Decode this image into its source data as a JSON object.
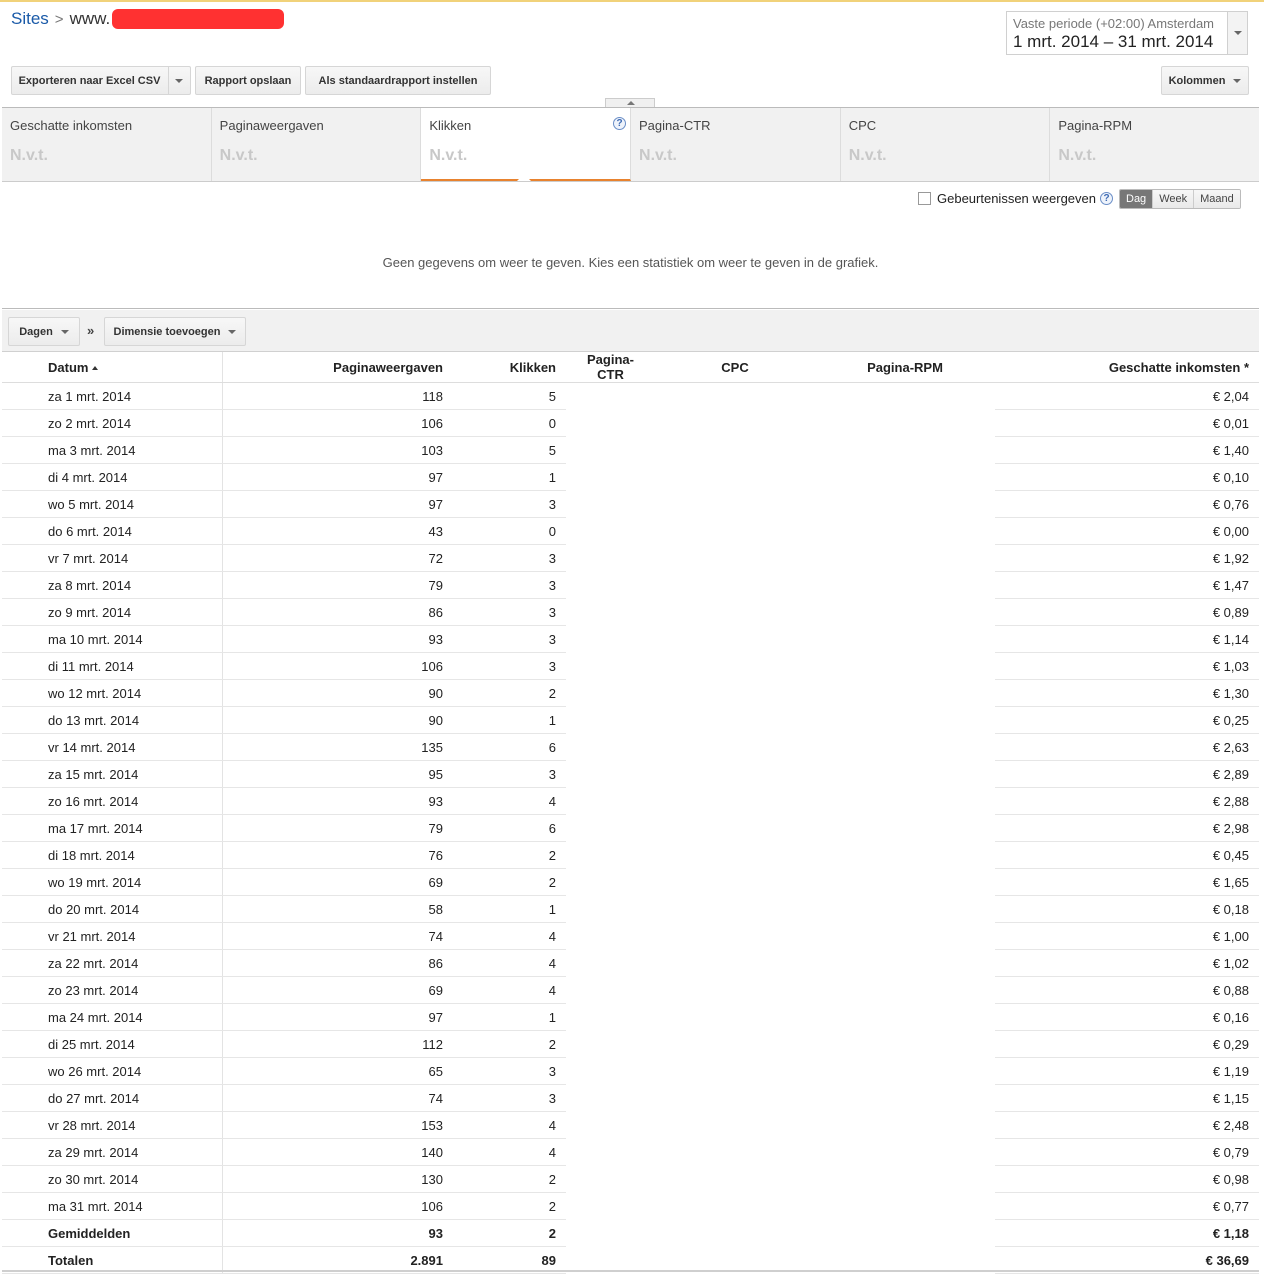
{
  "breadcrumb": {
    "root": "Sites",
    "separator": ">",
    "site_prefix": "www."
  },
  "daterange": {
    "label": "Vaste periode (+02:00) Amsterdam",
    "value": "1 mrt. 2014 – 31 mrt. 2014"
  },
  "toolbar": {
    "export_label": "Exporteren naar Excel CSV",
    "save_label": "Rapport opslaan",
    "default_label": "Als standaardrapport instellen",
    "columns_label": "Kolommen"
  },
  "metrics": [
    {
      "name": "Geschatte inkomsten",
      "value": "N.v.t."
    },
    {
      "name": "Paginaweergaven",
      "value": "N.v.t."
    },
    {
      "name": "Klikken",
      "value": "N.v.t.",
      "help": "?"
    },
    {
      "name": "Pagina-CTR",
      "value": "N.v.t."
    },
    {
      "name": "CPC",
      "value": "N.v.t."
    },
    {
      "name": "Pagina-RPM",
      "value": "N.v.t."
    }
  ],
  "chart": {
    "events_label": "Gebeurtenissen weergeven",
    "help": "?",
    "granularity": [
      "Dag",
      "Week",
      "Maand"
    ],
    "selected_granularity": "Dag",
    "no_data": "Geen gegevens om weer te geven. Kies een statistiek om weer te geven in de grafiek."
  },
  "dimensions": {
    "days_label": "Dagen",
    "chevron": "»",
    "add_label": "Dimensie toevoegen"
  },
  "table": {
    "headers": [
      "Datum",
      "Paginaweergaven",
      "Klikken",
      "Pagina-CTR",
      "CPC",
      "Pagina-RPM",
      "Geschatte inkomsten *"
    ],
    "rows": [
      [
        "za 1 mrt. 2014",
        "118",
        "5",
        "€ 2,04"
      ],
      [
        "zo 2 mrt. 2014",
        "106",
        "0",
        "€ 0,01"
      ],
      [
        "ma 3 mrt. 2014",
        "103",
        "5",
        "€ 1,40"
      ],
      [
        "di 4 mrt. 2014",
        "97",
        "1",
        "€ 0,10"
      ],
      [
        "wo 5 mrt. 2014",
        "97",
        "3",
        "€ 0,76"
      ],
      [
        "do 6 mrt. 2014",
        "43",
        "0",
        "€ 0,00"
      ],
      [
        "vr 7 mrt. 2014",
        "72",
        "3",
        "€ 1,92"
      ],
      [
        "za 8 mrt. 2014",
        "79",
        "3",
        "€ 1,47"
      ],
      [
        "zo 9 mrt. 2014",
        "86",
        "3",
        "€ 0,89"
      ],
      [
        "ma 10 mrt. 2014",
        "93",
        "3",
        "€ 1,14"
      ],
      [
        "di 11 mrt. 2014",
        "106",
        "3",
        "€ 1,03"
      ],
      [
        "wo 12 mrt. 2014",
        "90",
        "2",
        "€ 1,30"
      ],
      [
        "do 13 mrt. 2014",
        "90",
        "1",
        "€ 0,25"
      ],
      [
        "vr 14 mrt. 2014",
        "135",
        "6",
        "€ 2,63"
      ],
      [
        "za 15 mrt. 2014",
        "95",
        "3",
        "€ 2,89"
      ],
      [
        "zo 16 mrt. 2014",
        "93",
        "4",
        "€ 2,88"
      ],
      [
        "ma 17 mrt. 2014",
        "79",
        "6",
        "€ 2,98"
      ],
      [
        "di 18 mrt. 2014",
        "76",
        "2",
        "€ 0,45"
      ],
      [
        "wo 19 mrt. 2014",
        "69",
        "2",
        "€ 1,65"
      ],
      [
        "do 20 mrt. 2014",
        "58",
        "1",
        "€ 0,18"
      ],
      [
        "vr 21 mrt. 2014",
        "74",
        "4",
        "€ 1,00"
      ],
      [
        "za 22 mrt. 2014",
        "86",
        "4",
        "€ 1,02"
      ],
      [
        "zo 23 mrt. 2014",
        "69",
        "4",
        "€ 0,88"
      ],
      [
        "ma 24 mrt. 2014",
        "97",
        "1",
        "€ 0,16"
      ],
      [
        "di 25 mrt. 2014",
        "112",
        "2",
        "€ 0,29"
      ],
      [
        "wo 26 mrt. 2014",
        "65",
        "3",
        "€ 1,19"
      ],
      [
        "do 27 mrt. 2014",
        "74",
        "3",
        "€ 1,15"
      ],
      [
        "vr 28 mrt. 2014",
        "153",
        "4",
        "€ 2,48"
      ],
      [
        "za 29 mrt. 2014",
        "140",
        "4",
        "€ 0,79"
      ],
      [
        "zo 30 mrt. 2014",
        "130",
        "2",
        "€ 0,98"
      ],
      [
        "ma 31 mrt. 2014",
        "106",
        "2",
        "€ 0,77"
      ]
    ],
    "averages": [
      "Gemiddelden",
      "93",
      "2",
      "€ 1,18"
    ],
    "totals": [
      "Totalen",
      "2.891",
      "89",
      "€ 36,69"
    ]
  }
}
